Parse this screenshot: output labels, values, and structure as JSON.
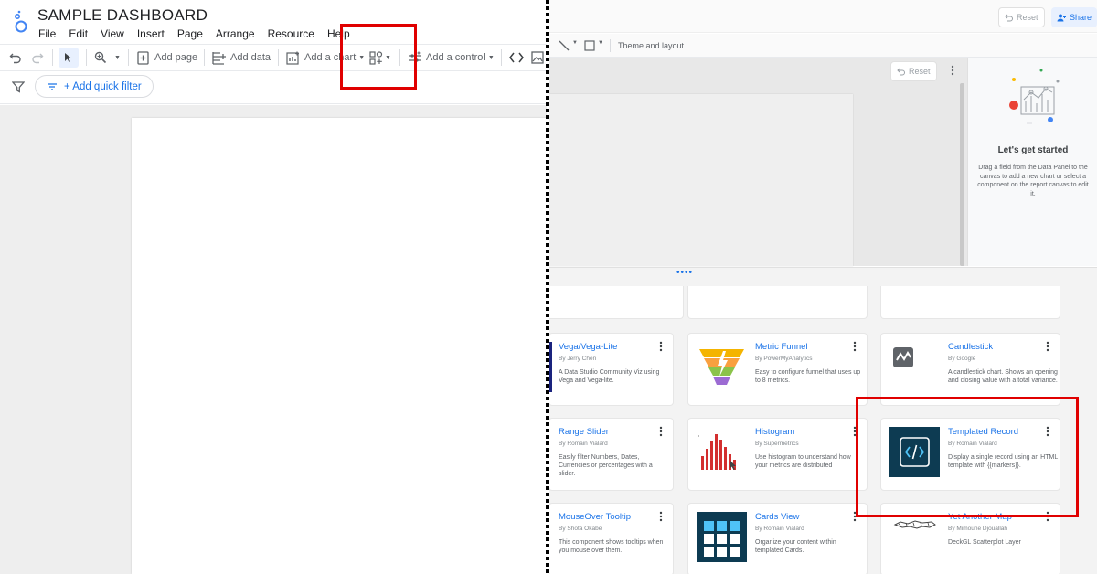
{
  "left": {
    "title": "SAMPLE DASHBOARD",
    "menu": [
      "File",
      "Edit",
      "View",
      "Insert",
      "Page",
      "Arrange",
      "Resource",
      "Help"
    ],
    "toolbar": {
      "add_page": "Add page",
      "add_data": "Add data",
      "add_chart": "Add a chart",
      "add_control": "Add a control"
    },
    "quick_filter": "+ Add quick filter"
  },
  "right": {
    "reset_top": "Reset",
    "share": "Share",
    "theme_layout": "Theme and layout",
    "reset_canvas": "Reset",
    "panel": {
      "heading": "Let's get started",
      "text": "Drag a field from the Data Panel to the canvas to add a new chart or select a component on the report canvas to edit it."
    },
    "cards": [
      {
        "name": "Vega/Vega-Lite",
        "by": "By Jerry Chen",
        "desc": "A Data Studio Community Viz using Vega and Vega-lite."
      },
      {
        "name": "Metric Funnel",
        "by": "By PowerMyAnalytics",
        "desc": "Easy to configure funnel that uses up to 8 metrics."
      },
      {
        "name": "Candlestick",
        "by": "By Google",
        "desc": "A candlestick chart. Shows an opening and closing value with a total variance."
      },
      {
        "name": "Range Slider",
        "by": "By Romain Vialard",
        "desc": "Easily filter Numbers, Dates, Currencies or percentages with a slider."
      },
      {
        "name": "Histogram",
        "by": "By Supermetrics",
        "desc": "Use histogram to understand how your metrics are distributed"
      },
      {
        "name": "Templated Record",
        "by": "By Romain Vialard",
        "desc": "Display a single record using an HTML template with {{markers}}."
      },
      {
        "name": "MouseOver Tooltip",
        "by": "By Shota Okabe",
        "desc": "This component shows tooltips when you mouse over them."
      },
      {
        "name": "Cards View",
        "by": "By Romain Vialard",
        "desc": "Organize your content within templated Cards."
      },
      {
        "name": "Yet Another Map",
        "by": "By Mimoune Djouallah",
        "desc": "DeckGL Scatterplot Layer"
      }
    ]
  },
  "colors": {
    "accent": "#1a73e8",
    "highlight": "#e00000",
    "templated_thumb": "#0d3b52"
  }
}
